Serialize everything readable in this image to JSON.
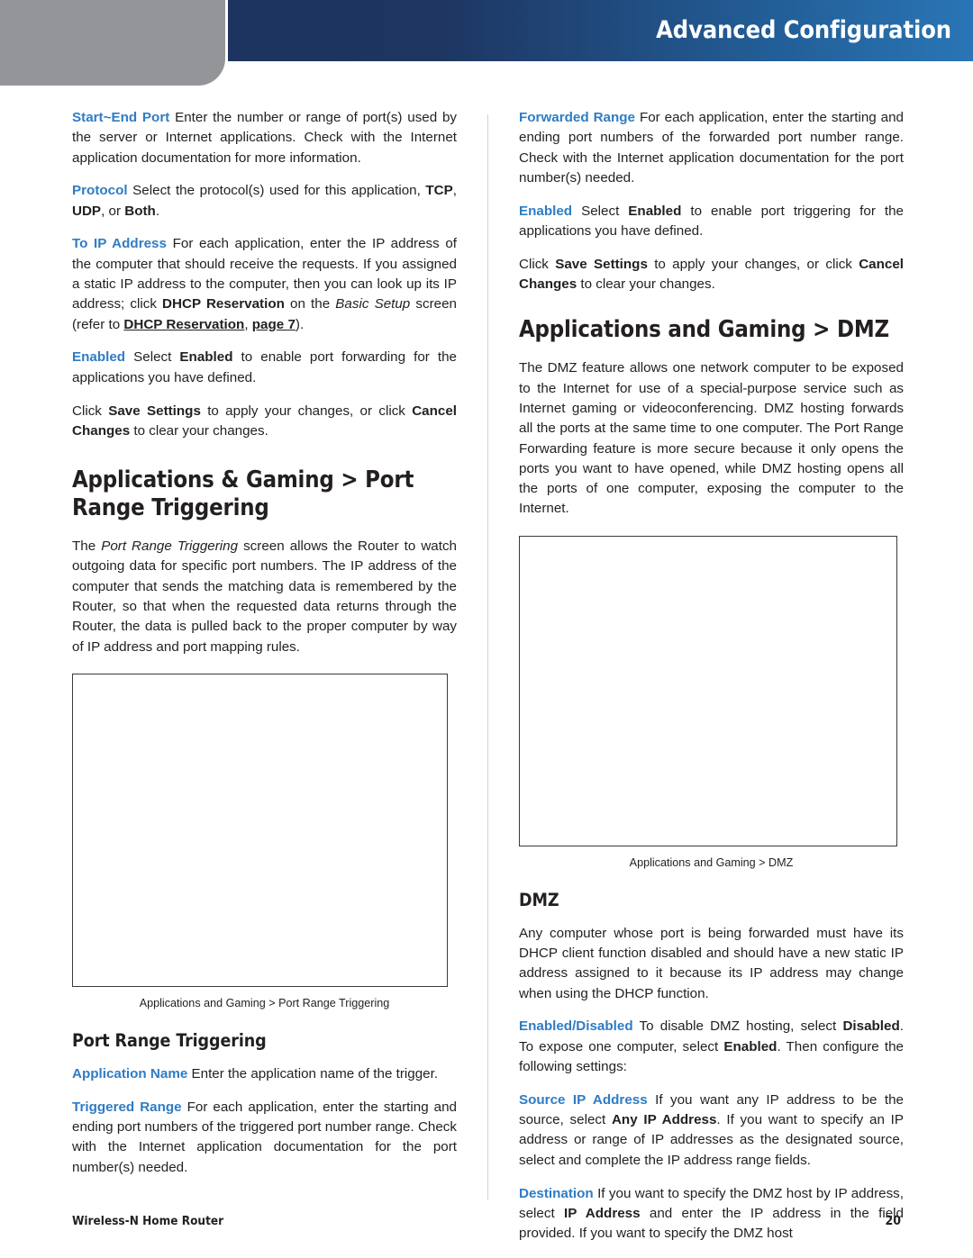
{
  "header": {
    "title": "Advanced Configuration",
    "gradient_start": "#1d3460",
    "gradient_end": "#2a75b5",
    "gray_block_color": "#939598"
  },
  "accent_color": "#2e7cc4",
  "left_column": {
    "p_start_end_port": {
      "term": "Start~End Port",
      "text": " Enter the number or range of port(s) used by the server or Internet applications. Check with the Internet application documentation for more information."
    },
    "p_protocol": {
      "term": "Protocol",
      "text_a": "  Select the protocol(s) used for this application, ",
      "b1": "TCP",
      "text_b": ", ",
      "b2": "UDP",
      "text_c": ", or ",
      "b3": "Both",
      "text_d": "."
    },
    "p_to_ip_address": {
      "term": "To IP Address",
      "text_a": "  For each application, enter the IP address of the computer that should receive the requests. If you assigned a static IP address to the computer, then you can look up its IP address; click ",
      "b1": "DHCP Reservation",
      "text_b": " on the ",
      "i1": "Basic Setup",
      "text_c": " screen (refer to ",
      "u1": "DHCP Reservation",
      "text_d": ", ",
      "u2": "page 7",
      "text_e": ")."
    },
    "p_enabled": {
      "term": "Enabled",
      "text_a": "  Select ",
      "b1": "Enabled",
      "text_b": " to enable port forwarding for the applications you have defined."
    },
    "p_save": {
      "text_a": "Click ",
      "b1": "Save Settings",
      "text_b": " to apply your changes, or click ",
      "b2": "Cancel Changes",
      "text_c": " to clear your changes."
    },
    "heading_port_range_triggering": "Applications & Gaming > Port Range Triggering",
    "p_port_range_triggering_intro": {
      "text_a": "The ",
      "i1": "Port Range Triggering",
      "text_b": " screen allows the Router to watch outgoing data for specific port numbers. The IP address of the computer that sends the matching data is remembered by the Router, so that when the requested data returns through the Router, the data is pulled back to the proper computer by way of IP address and port mapping rules."
    },
    "figure_caption": "Applications and Gaming > Port Range Triggering",
    "subheading_port_range_triggering": "Port Range Triggering",
    "p_application_name": {
      "term": "Application Name",
      "text": " Enter the application name of the trigger."
    },
    "p_triggered_range": {
      "term": "Triggered Range",
      "text": "  For each application, enter the starting and ending port numbers of the triggered port number range. Check with the Internet application documentation for the port number(s) needed."
    }
  },
  "right_column": {
    "p_forwarded_range": {
      "term": "Forwarded Range",
      "text": "  For each application, enter the starting and ending port numbers of the forwarded port number range. Check with the Internet application documentation for the port number(s) needed."
    },
    "p_enabled": {
      "term": "Enabled",
      "text_a": "  Select ",
      "b1": "Enabled",
      "text_b": " to enable port triggering for the applications you have defined."
    },
    "p_save": {
      "text_a": "Click ",
      "b1": "Save Settings",
      "text_b": " to apply your changes, or click ",
      "b2": "Cancel Changes",
      "text_c": " to clear your changes."
    },
    "heading_dmz": "Applications and Gaming > DMZ",
    "p_dmz_intro": "The DMZ feature allows one network computer to be exposed to the Internet for use of a special-purpose service such as Internet gaming or videoconferencing. DMZ hosting forwards all the ports at the same time to one computer. The Port Range Forwarding feature is more secure because it only opens the ports you want to have opened, while DMZ hosting opens all the ports of one computer, exposing the computer to the Internet.",
    "figure_caption": "Applications and Gaming > DMZ",
    "subheading_dmz": "DMZ",
    "p_dmz_body": "Any computer whose port is being forwarded must have its DHCP client function disabled and should have a new static IP address assigned to it because its IP address may change when using the DHCP function.",
    "p_enabled_disabled": {
      "term": "Enabled/Disabled",
      "text_a": " To disable DMZ hosting, select ",
      "b1": "Disabled",
      "text_b": ". To expose one computer, select ",
      "b2": "Enabled",
      "text_c": ". Then configure the following settings:"
    },
    "p_source_ip_address": {
      "term": "Source IP Address",
      "text_a": "  If you want any IP address to be the source, select ",
      "b1": "Any IP Address",
      "text_b": ". If you want to specify an IP address or range of IP addresses as the designated source, select and complete the IP address range fields."
    },
    "p_destination": {
      "term": "Destination",
      "text_a": "  If you want to specify the DMZ host by IP address, select ",
      "b1": "IP Address",
      "text_b": " and enter the IP address in the field provided. If you want to specify the DMZ host"
    }
  },
  "footer": {
    "product": "Wireless-N Home Router",
    "page_number": "20"
  }
}
